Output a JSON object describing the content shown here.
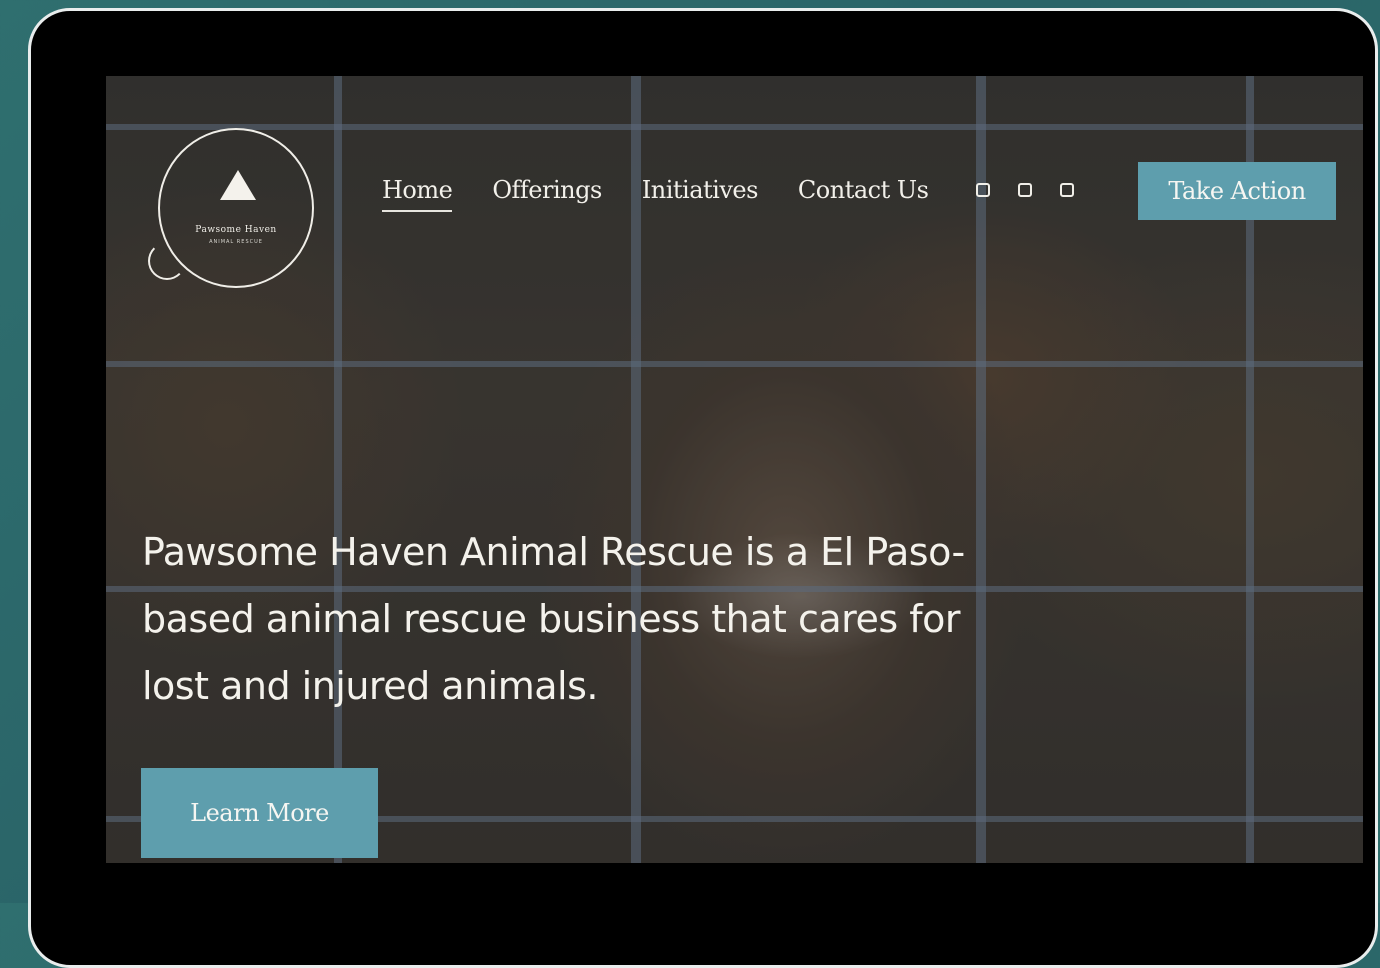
{
  "brand": {
    "logo_name": "Pawsome Haven",
    "logo_tagline": "ANIMAL RESCUE"
  },
  "nav": {
    "items": [
      {
        "label": "Home",
        "active": true
      },
      {
        "label": "Offerings",
        "active": false
      },
      {
        "label": "Initiatives",
        "active": false
      },
      {
        "label": "Contact Us",
        "active": false
      }
    ],
    "social_icons": [
      "facebook-icon",
      "instagram-icon",
      "twitter-icon"
    ],
    "cta_label": "Take Action"
  },
  "hero": {
    "headline_lines": [
      "Pawsome Haven Animal Rescue is a El Paso-",
      "based animal rescue business that cares for",
      "lost and injured animals."
    ],
    "button_label": "Learn More",
    "background_image": "australian-shepherd-behind-fence"
  },
  "colors": {
    "accent": "#5e9ead",
    "page_background": "#2d6b6c",
    "device_frame": "#000000"
  }
}
